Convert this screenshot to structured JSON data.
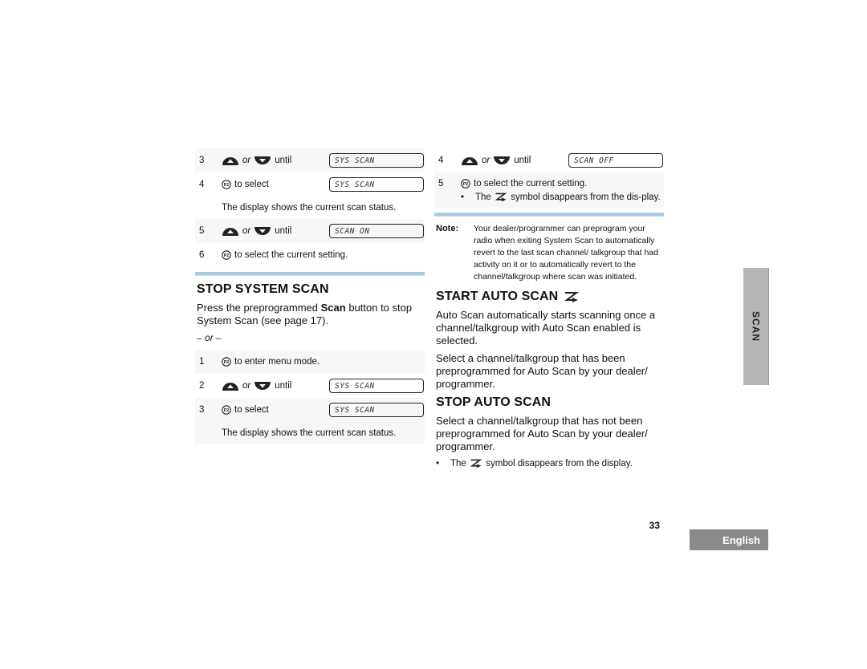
{
  "left_column": {
    "steps_a": [
      {
        "num": "3",
        "type": "nav",
        "or": "or",
        "until": "until",
        "lcd": "SYS SCAN",
        "shaded": true
      },
      {
        "num": "4",
        "type": "select",
        "text": "to select",
        "lcd": "SYS SCAN",
        "shaded": false
      }
    ],
    "status_note_a": "The display shows the current scan status.",
    "steps_b": [
      {
        "num": "5",
        "type": "nav",
        "or": "or",
        "until": "until",
        "lcd": "SCAN ON",
        "shaded": true
      },
      {
        "num": "6",
        "type": "select",
        "text": "to select the current setting.",
        "shaded": false
      }
    ],
    "stop_system_scan": {
      "heading": "STOP SYSTEM SCAN",
      "para_pre": "Press the preprogrammed ",
      "para_bold": "Scan",
      "para_post": " button to stop System Scan (see page 17).",
      "or_line": "– or –"
    },
    "steps_c": [
      {
        "num": "1",
        "text": "to enter menu mode.",
        "shaded": true
      },
      {
        "num": "2",
        "or": "or",
        "until": "until",
        "lcd": "SYS SCAN",
        "shaded": false
      },
      {
        "num": "3",
        "text": "to select",
        "lcd": "SYS SCAN",
        "shaded": true
      }
    ],
    "status_note_c": "The display shows the current scan status."
  },
  "right_column": {
    "step4": {
      "num": "4",
      "or": "or",
      "until": "until",
      "lcd": "SCAN OFF"
    },
    "step5": {
      "num": "5",
      "text": "to select the current setting.",
      "bullet_pre": "The",
      "bullet_post": "symbol disappears from the dis-play."
    },
    "note": {
      "label": "Note:",
      "text": "Your dealer/programmer can preprogram your radio when exiting System Scan to automatically revert to the last scan channel/ talkgroup that had activity on it or to automatically revert to the channel/talkgroup where scan was initiated."
    },
    "start_auto_scan": {
      "heading": "START AUTO SCAN",
      "para1": "Auto Scan automatically starts scanning once a channel/talkgroup with Auto Scan enabled is selected.",
      "para2": "Select a channel/talkgroup that has been preprogrammed for Auto Scan by your dealer/ programmer."
    },
    "stop_auto_scan": {
      "heading": "STOP AUTO SCAN",
      "para": "Select a channel/talkgroup that has not been preprogrammed for Auto Scan by your dealer/ programmer.",
      "bullet_pre": "The",
      "bullet_post": "symbol disappears from the display."
    }
  },
  "side_tab": "SCAN",
  "page_number": "33",
  "language_tab": "English",
  "icons": {
    "up": "up-arrow-button-icon",
    "down": "down-arrow-button-icon",
    "p2": "p2-button-icon",
    "autoscan": "auto-scan-icon"
  },
  "colors": {
    "rule": "#a9cbe0",
    "shade": "#f5f7f9",
    "side_tab": "#b5b5b5",
    "lang_tab": "#8a8a8a"
  }
}
